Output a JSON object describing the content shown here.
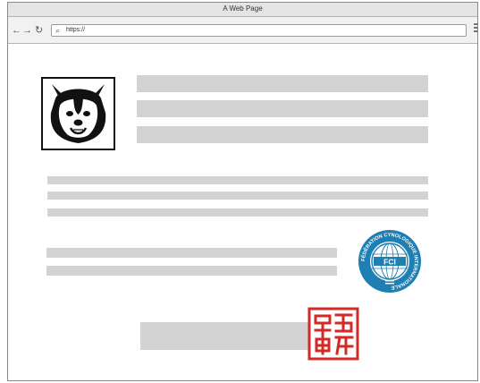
{
  "window": {
    "title": "A Web Page"
  },
  "toolbar": {
    "back_icon": "back-arrow-icon",
    "forward_icon": "forward-arrow-icon",
    "reload_icon": "reload-icon",
    "search_icon": "search-icon",
    "url": "https://",
    "menu_icon": "hamburger-menu-icon"
  },
  "images": {
    "logo": "husky-dog-logo",
    "badge": "fci-emblem",
    "badge_text": "FÉDÉRATION CYNOLOGIQUE INTERNATIONALE",
    "badge_center": "FCI",
    "seal": "red-chinese-seal-stamp"
  },
  "colors": {
    "placeholder": "#d3d3d3",
    "fci_blue": "#1f7fb3",
    "seal_red": "#d22a24"
  }
}
